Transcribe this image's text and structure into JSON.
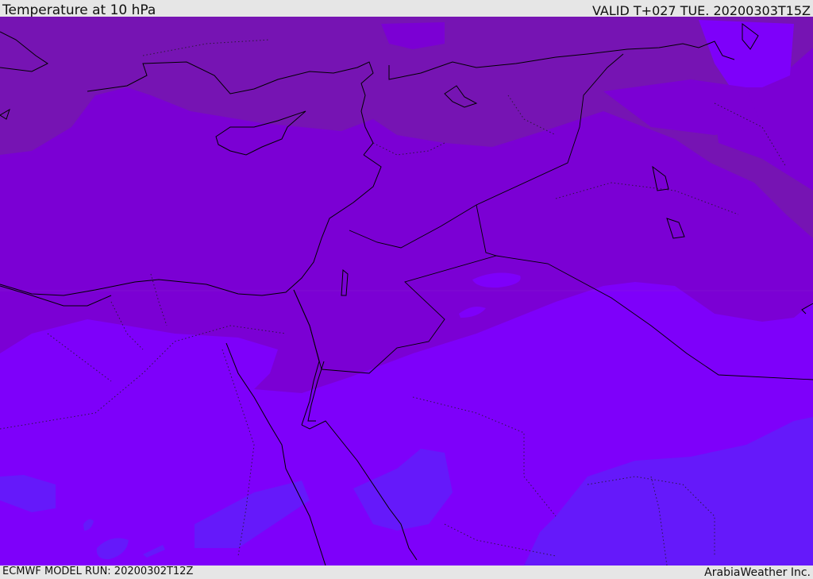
{
  "header": {
    "title": "Temperature at 10 hPa",
    "valid": "VALID T+027 TUE. 20200303T15Z"
  },
  "footer": {
    "model_run": "ECMWF MODEL RUN: 20200302T12Z",
    "brand": "ArabiaWeather Inc."
  },
  "colors": {
    "band_warm": "#7614b3",
    "band_mid": "#7b00d4",
    "band_cool": "#7e00fa",
    "band_coldest": "#6519fa",
    "coastline": "#000000",
    "frame": "#e6e6e6"
  }
}
